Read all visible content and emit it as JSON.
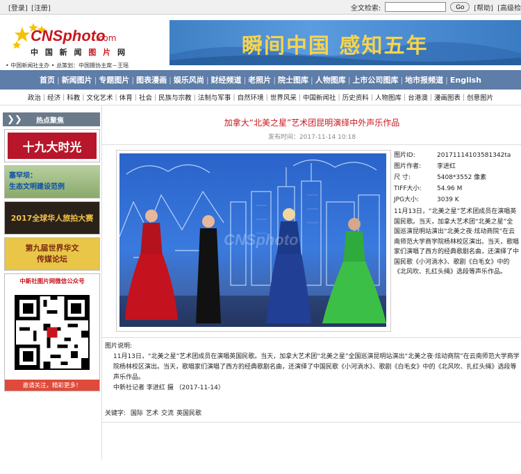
{
  "topbar": {
    "login": "[登录]",
    "register": "[注册]",
    "search_label": "全文检索:",
    "search_value": "",
    "go": "Go",
    "help": "[帮助]",
    "advanced": "[高级检"
  },
  "header": {
    "logo_en": "CNSphoto",
    "logo_dotcom": ".com",
    "logo_cn_a": "中 国 新 闻 ",
    "logo_cn_b": "图 片",
    "logo_cn_c": " 网",
    "tagline": "• 中国新闻社主办 • 总策划：中国摄协主席－王瑶",
    "banner_text": "瞬间中国  感知五年"
  },
  "nav": {
    "items": [
      "首页",
      "新闻图片",
      "专题图片",
      "图表漫画",
      "娱乐风尚",
      "财经频道",
      "老照片",
      "院士图库",
      "人物图库",
      "上市公司图库",
      "地市报频道",
      "English"
    ]
  },
  "subnav": {
    "items": [
      "政治",
      "经济",
      "科教",
      "文化艺术",
      "体育",
      "社会",
      "民族与宗教",
      "法制与军事",
      "自然环境",
      "世界风采",
      "中国新闻社",
      "历史资料",
      "人物图库",
      "台港澳",
      "漫画图表",
      "创意图片"
    ]
  },
  "sidebar": {
    "title": "热点聚焦",
    "promo1": "十九大时光",
    "promo2_line1": "塞罕坝：",
    "promo2_line2": "生态文明建设范例",
    "promo3": "2017全球华人旅拍大赛",
    "promo4_line1": "第九届世界华文",
    "promo4_line2": "传媒论坛",
    "qr_header": "中新社图片网微信公众号",
    "qr_footer": "邀请关注，精彩更多！"
  },
  "article": {
    "title": "加拿大“北美之星”艺术团昆明演绎中外声乐作品",
    "publish_time": "发布时间：2017-11-14 10:18",
    "watermark": "CNSphoto"
  },
  "info": {
    "photo_id_label": "图片ID:",
    "photo_id": "20171114103581342ta",
    "author_label": "图片作者:",
    "author": "李进红",
    "size_label": "尺      寸:",
    "size": "5408*3552 像素",
    "tiff_label": "TIFF大小:",
    "tiff": "54.96  M",
    "jpg_label": "JPG大小:",
    "jpg": "3039  K",
    "description": "11月13日，“北美之星”艺术团成员在演唱英国民歌。当天，加拿大艺术团“北美之星”全国巡演昆明站演出“北美之夜·炫动商院”在云南师范大学商学院杨林校区演出。当天，歌唱家们演唱了西方的经典歌剧名曲，还演绎了中国民歌《小河淌水》、歌剧《白毛女》中的《北风吹、扎红头绳》选段等声乐作品。"
  },
  "caption": {
    "label": "图片说明:",
    "body": "11月13日，“北美之星”艺术团成员在演唱英国民歌。当天，加拿大艺术团“北美之星”全国巡演昆明站演出“北美之夜·炫动商院”在云南师范大学商学院杨林校区演出。当天，歌唱家们演唱了西方的经典歌剧名曲，还演绎了中国民歌《小河淌水》、歌剧《白毛女》中的《北风吹、扎红头绳》选段等声乐作品。",
    "credit": "中新社记者 李进红 摄   （2017-11-14）"
  },
  "keywords": {
    "label": "关键字:",
    "items": [
      "国际",
      "艺术",
      "交流",
      "英国民歌"
    ]
  },
  "colors": {
    "brand_red": "#c8161d",
    "nav_bg": "#5e7da8",
    "banner_text": "#f7d44a"
  }
}
